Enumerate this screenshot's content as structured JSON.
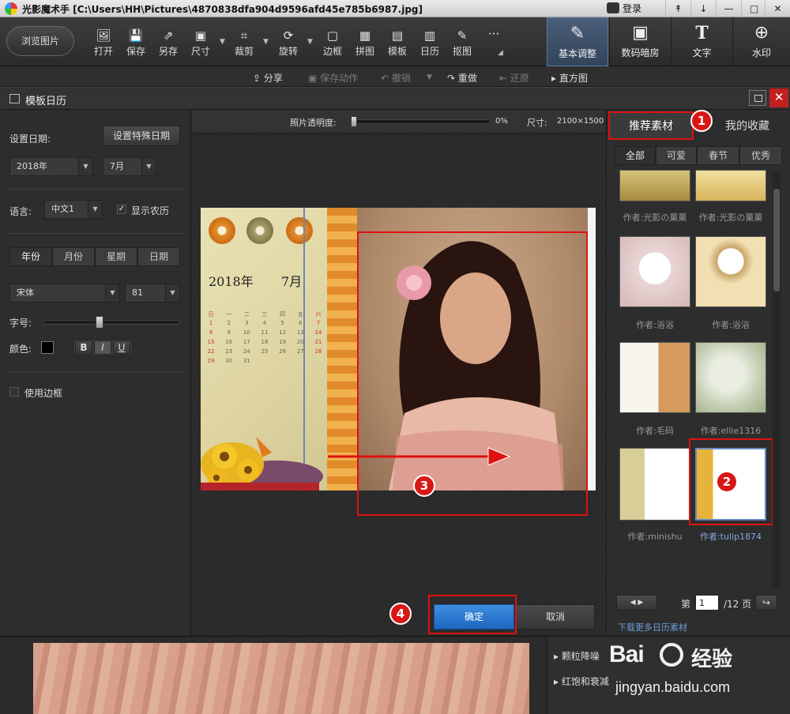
{
  "titlebar": {
    "title": "光影魔术手 [C:\\Users\\HH\\Pictures\\4870838dfa904d9596afd45e785b6987.jpg]",
    "login_label": "登录",
    "buttons": [
      "↟",
      "↓",
      "—",
      "□",
      "✕"
    ]
  },
  "toolbar": {
    "browse_label": "浏览图片",
    "tools": [
      {
        "label": "打开",
        "icon": "open-icon",
        "glyph": "🖼"
      },
      {
        "label": "保存",
        "icon": "save-icon",
        "glyph": "💾"
      },
      {
        "label": "另存",
        "icon": "save-as-icon",
        "glyph": "⇗"
      },
      {
        "label": "尺寸",
        "icon": "resize-icon",
        "glyph": "▣"
      },
      {
        "label": "裁剪",
        "icon": "crop-icon",
        "glyph": "⌗"
      },
      {
        "label": "旋转",
        "icon": "rotate-icon",
        "glyph": "⟳"
      },
      {
        "label": "边框",
        "icon": "border-icon",
        "glyph": "▢"
      },
      {
        "label": "拼图",
        "icon": "collage-icon",
        "glyph": "▦"
      },
      {
        "label": "模板",
        "icon": "template-icon",
        "glyph": "▤"
      },
      {
        "label": "日历",
        "icon": "calendar-icon",
        "glyph": "▥"
      },
      {
        "label": "抠图",
        "icon": "cutout-icon",
        "glyph": "✎"
      }
    ],
    "more_glyph": "···",
    "tabs": [
      {
        "label": "基本调整",
        "icon": "basic-adjust-icon",
        "glyph": "✎",
        "active": true
      },
      {
        "label": "数码暗房",
        "icon": "darkroom-icon",
        "glyph": "▣",
        "active": false
      },
      {
        "label": "文字",
        "icon": "text-icon",
        "glyph": "T",
        "active": false
      },
      {
        "label": "水印",
        "icon": "watermark-icon",
        "glyph": "⊕",
        "active": false
      }
    ]
  },
  "subbar": {
    "share": "分享",
    "save_action": "保存动作",
    "undo": "撤销",
    "redo": "重做",
    "restore": "还原",
    "histogram": "直方图"
  },
  "dialog": {
    "title": "模板日历",
    "close_glyph": "✕"
  },
  "left": {
    "set_date_label": "设置日期:",
    "special_date_button": "设置特殊日期",
    "year_value": "2018年",
    "month_value": "7月",
    "language_label": "语言:",
    "language_value": "中文1",
    "show_lunar_label": "显示农历",
    "show_lunar_checked": true,
    "segments": [
      "年份",
      "月份",
      "星期",
      "日期"
    ],
    "font_value": "宋体",
    "size_value": "81",
    "size_label": "字号:",
    "color_label": "颜色:",
    "color_value": "#000000",
    "format_buttons": [
      "B",
      "I",
      "U"
    ],
    "use_border_label": "使用边框",
    "use_border_checked": false,
    "font_size_level": 0.4
  },
  "center": {
    "opacity_label": "照片透明度:",
    "opacity_value": "0%",
    "size_label": "尺寸:",
    "size_value": "2100×1500",
    "confirm_label": "确定",
    "cancel_label": "取消",
    "calendar": {
      "year": "2018年",
      "month": "7月",
      "weekdays": [
        "日",
        "一",
        "二",
        "三",
        "四",
        "五",
        "六"
      ],
      "weeks": [
        [
          "1",
          "2",
          "3",
          "4",
          "5",
          "6",
          "7"
        ],
        [
          "8",
          "9",
          "10",
          "11",
          "12",
          "13",
          "14"
        ],
        [
          "15",
          "16",
          "17",
          "18",
          "19",
          "20",
          "21"
        ],
        [
          "22",
          "23",
          "24",
          "25",
          "26",
          "27",
          "28"
        ],
        [
          "29",
          "30",
          "31",
          "",
          "",
          "",
          ""
        ]
      ]
    }
  },
  "right": {
    "tab_recommended": "推荐素材",
    "tab_favorites": "我的收藏",
    "filters": [
      "全部",
      "可爱",
      "春节",
      "优秀"
    ],
    "items": [
      {
        "author": "作者:光影の菓菓"
      },
      {
        "author": "作者:光影の菓菓"
      },
      {
        "author": "作者:浴浴"
      },
      {
        "author": "作者:浴浴"
      },
      {
        "author": "作者:毛码"
      },
      {
        "author": "作者:ellie1316"
      },
      {
        "author": "作者:minishu"
      },
      {
        "author": "作者:tulip1874"
      }
    ],
    "page_prefix": "第",
    "page_value": "1",
    "page_suffix": "/12 页",
    "download_more": "下载更多日历素材"
  },
  "bottom": {
    "items": [
      "颗粒降噪",
      "红饱和衰减"
    ]
  },
  "annotations": [
    "1",
    "2",
    "3",
    "4"
  ],
  "watermark": {
    "brand": "Bai",
    "brand2": "经验",
    "url": "jingyan.baidu.com"
  }
}
